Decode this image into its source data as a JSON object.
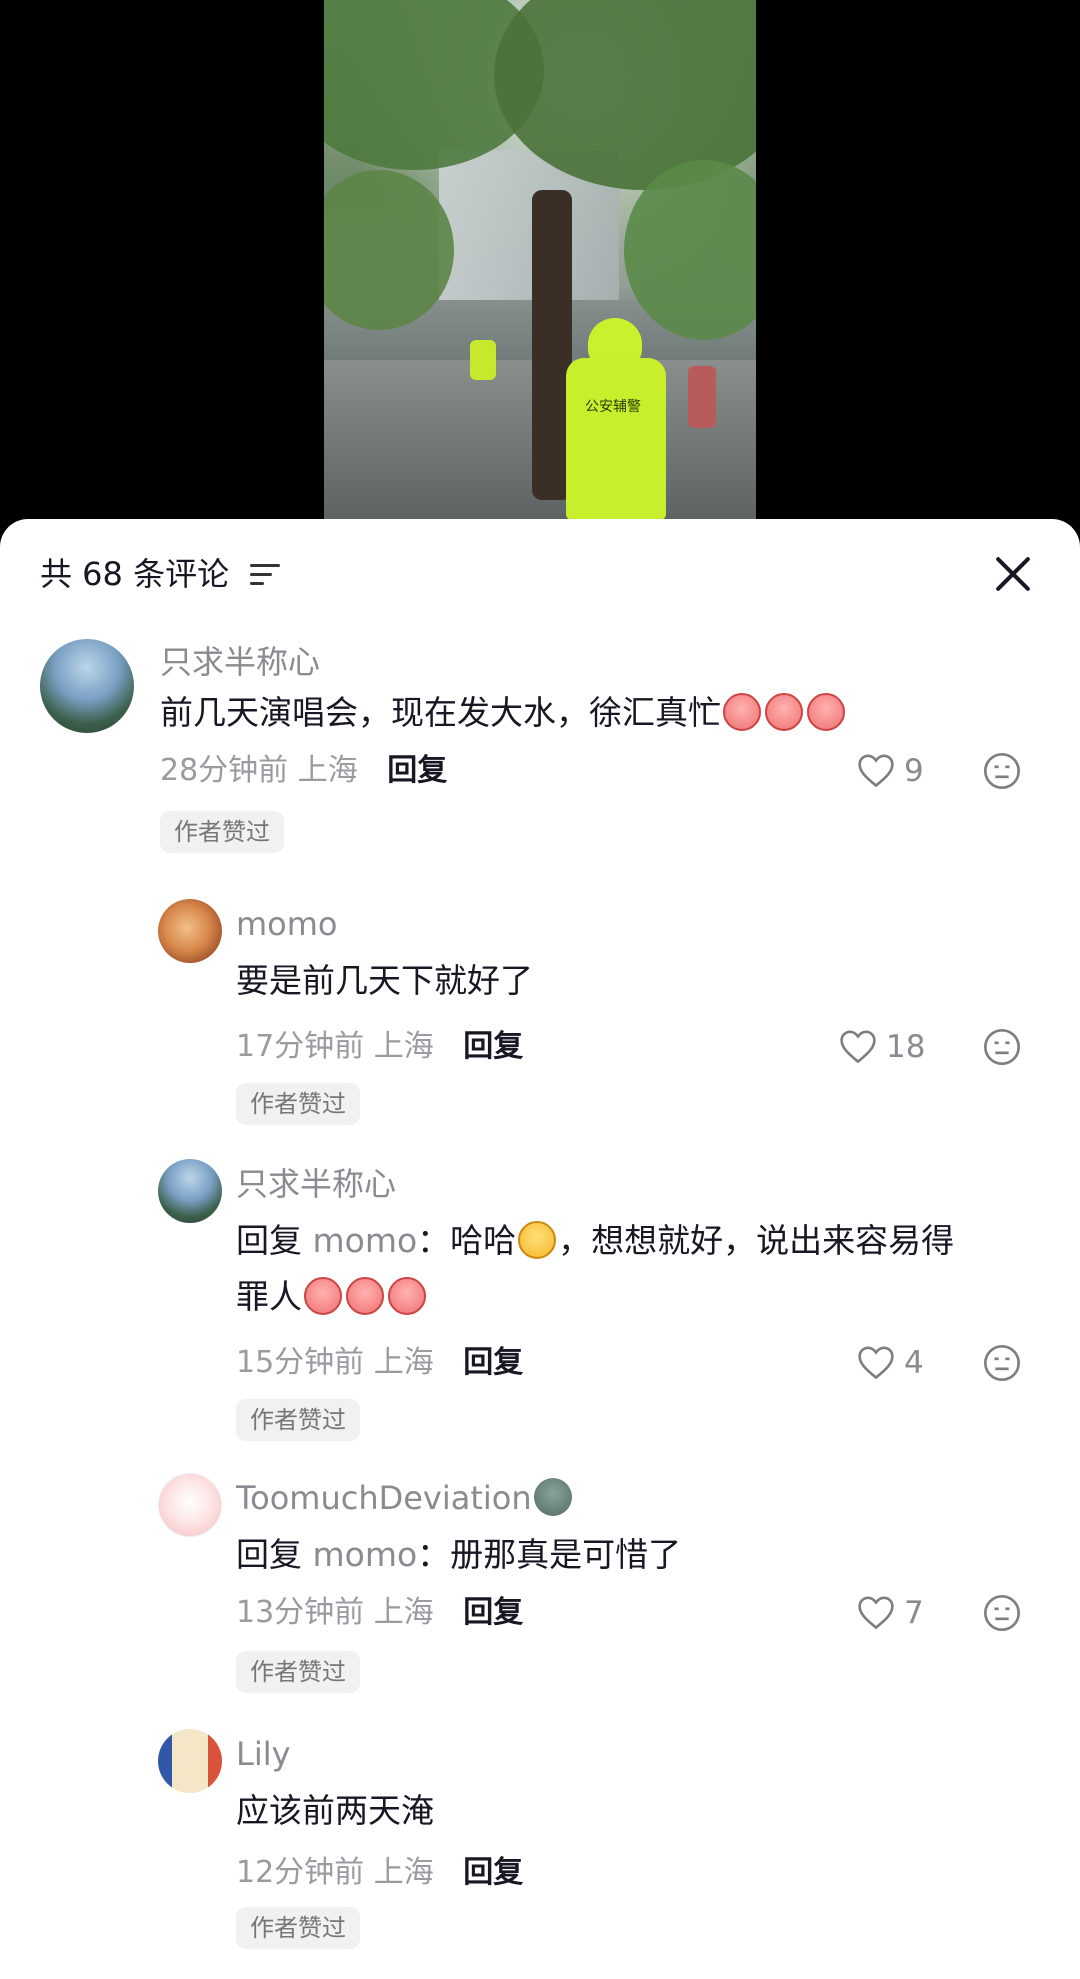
{
  "video": {
    "vest_label": "公安辅警"
  },
  "header": {
    "count_label": "共 68 条评论"
  },
  "comments": [
    {
      "user": "只求半称心",
      "text_main": "前几天演唱会，现在发大水，徐汇真忙",
      "time": "28分钟前",
      "location": "上海",
      "reply_label": "回复",
      "likes": "9",
      "tag": "作者赞过"
    },
    {
      "user": "momo",
      "text_main": "要是前几天下就好了",
      "time": "17分钟前",
      "location": "上海",
      "reply_label": "回复",
      "likes": "18",
      "tag": "作者赞过"
    },
    {
      "user": "只求半称心",
      "reply_word": "回复",
      "mention": "momo",
      "text_a": "：哈哈",
      "text_b": "，想想就好，说出来容易得",
      "text_line2": "罪人",
      "time": "15分钟前",
      "location": "上海",
      "reply_label": "回复",
      "likes": "4",
      "tag": "作者赞过"
    },
    {
      "user": "ToomuchDeviation",
      "reply_word": "回复",
      "mention": "momo",
      "text_a": "：册那真是可惜了",
      "time": "13分钟前",
      "location": "上海",
      "reply_label": "回复",
      "likes": "7",
      "tag": "作者赞过"
    },
    {
      "user": "Lily",
      "text_main": "应该前两天淹",
      "time": "12分钟前",
      "location": "上海",
      "reply_label": "回复",
      "tag": "作者赞过"
    }
  ],
  "icons": {
    "sort": "sort-icon",
    "close": "close-icon",
    "like": "heart-outline-icon",
    "dislike": "dislike-face-icon"
  }
}
